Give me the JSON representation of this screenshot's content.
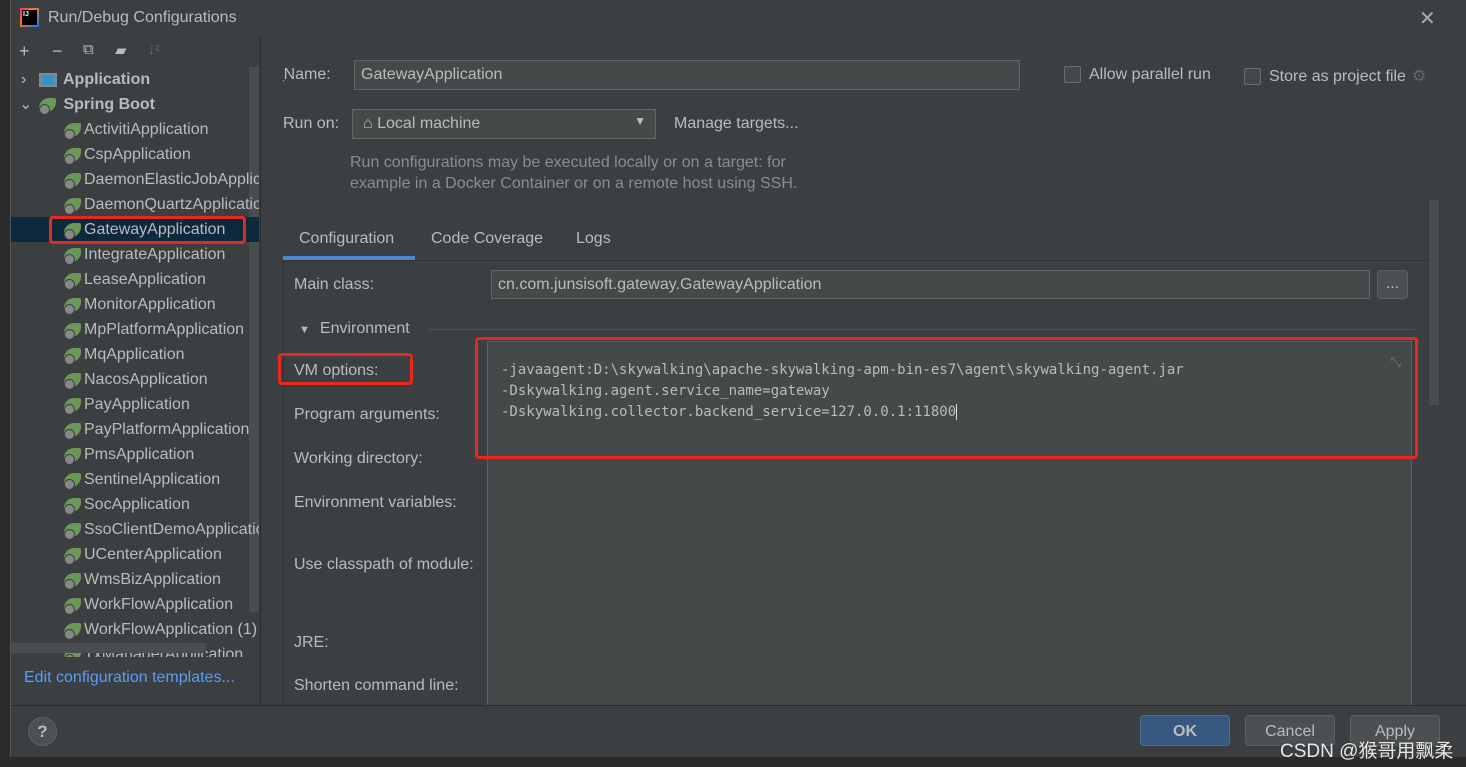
{
  "window": {
    "title": "Run/Debug Configurations",
    "close_icon": "close-icon"
  },
  "toolbar": {
    "add": "+",
    "remove": "−",
    "copy": "copy-icon",
    "folder": "new-folder-icon",
    "sort": "sort-icon"
  },
  "tree": {
    "groups": [
      {
        "label": "Application",
        "expanded": false
      },
      {
        "label": "Spring Boot",
        "expanded": true
      }
    ],
    "items": [
      "ActivitiApplication",
      "CspApplication",
      "DaemonElasticJobApplication",
      "DaemonQuartzApplication",
      "GatewayApplication",
      "IntegrateApplication",
      "LeaseApplication",
      "MonitorApplication",
      "MpPlatformApplication",
      "MqApplication",
      "NacosApplication",
      "PayApplication",
      "PayPlatformApplication",
      "PmsApplication",
      "SentinelApplication",
      "SocApplication",
      "SsoClientDemoApplication",
      "UCenterApplication",
      "WmsBizApplication",
      "WorkFlowApplication",
      "WorkFlowApplication (1)",
      "TxManagerApplication"
    ],
    "selected": "GatewayApplication"
  },
  "edit_templates": "Edit configuration templates...",
  "form": {
    "name_label": "Name:",
    "name_value": "GatewayApplication",
    "allow_parallel": "Allow parallel run",
    "allow_parallel_checked": false,
    "store_project": "Store as project file",
    "store_project_checked": false,
    "run_on_label": "Run on:",
    "run_on_value": "Local machine",
    "manage_targets": "Manage targets...",
    "hint_line1": "Run configurations may be executed locally or on a target: for",
    "hint_line2": "example in a Docker Container or on a remote host using SSH.",
    "tabs": [
      "Configuration",
      "Code Coverage",
      "Logs"
    ],
    "active_tab": "Configuration",
    "main_class_label": "Main class:",
    "main_class_value": "cn.com.junsisoft.gateway.GatewayApplication",
    "browse": "...",
    "environment": "Environment",
    "vm_label": "VM options:",
    "vm_lines": [
      "-javaagent:D:\\skywalking\\apache-skywalking-apm-bin-es7\\agent\\skywalking-agent.jar",
      "-Dskywalking.agent.service_name=gateway",
      "-Dskywalking.collector.backend_service=127.0.0.1:11800"
    ],
    "program_args": "Program arguments:",
    "working_dir": "Working directory:",
    "env_vars": "Environment variables:",
    "classpath": "Use classpath of module:",
    "jre": "JRE:",
    "shorten": "Shorten command line:"
  },
  "buttons": {
    "help": "?",
    "ok": "OK",
    "cancel": "Cancel",
    "apply": "Apply"
  },
  "watermark": "CSDN @猴哥用飘柔",
  "colors": {
    "accent": "#589df6",
    "highlight": "#e8281f",
    "ok": "#365880"
  }
}
